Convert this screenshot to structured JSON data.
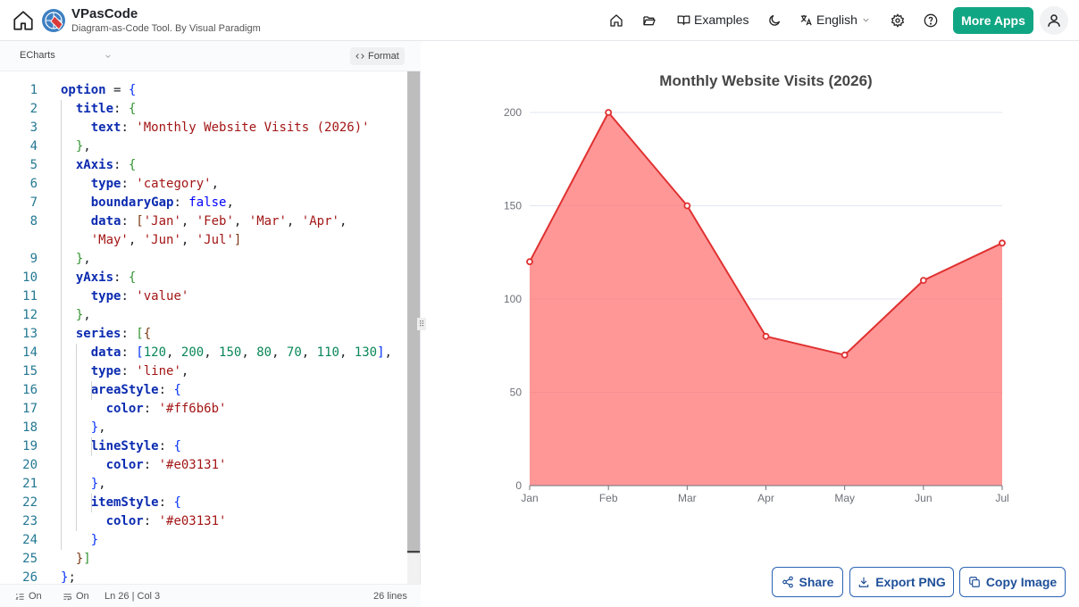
{
  "header": {
    "brand_title": "VPasCode",
    "brand_subtitle": "Diagram-as-Code Tool. By Visual Paradigm",
    "examples_label": "Examples",
    "language_label": "English",
    "more_apps_label": "More Apps"
  },
  "editor": {
    "language": "ECharts",
    "format_label": "Format",
    "lines": [
      {
        "n": "1",
        "html": "<span class=\"k\">option</span> = <span class=\"p1\">{</span>"
      },
      {
        "n": "2",
        "html": "  <span class=\"k\">title</span>: <span class=\"p2\">{</span>"
      },
      {
        "n": "3",
        "html": "    <span class=\"k\">text</span>: <span class=\"s\">'Monthly Website Visits (2026)'</span>"
      },
      {
        "n": "4",
        "html": "  <span class=\"p2\">}</span>,"
      },
      {
        "n": "5",
        "html": "  <span class=\"k\">xAxis</span>: <span class=\"p2\">{</span>"
      },
      {
        "n": "6",
        "html": "    <span class=\"k\">type</span>: <span class=\"s\">'category'</span>,"
      },
      {
        "n": "7",
        "html": "    <span class=\"k\">boundaryGap</span>: <span class=\"b\">false</span>,"
      },
      {
        "n": "8",
        "html": "    <span class=\"k\">data</span>: <span class=\"p3\">[</span><span class=\"s\">'Jan'</span>, <span class=\"s\">'Feb'</span>, <span class=\"s\">'Mar'</span>, <span class=\"s\">'Apr'</span>,"
      },
      {
        "n": "",
        "html": "    <span class=\"s\">'May'</span>, <span class=\"s\">'Jun'</span>, <span class=\"s\">'Jul'</span><span class=\"p3\">]</span>"
      },
      {
        "n": "9",
        "html": "  <span class=\"p2\">}</span>,"
      },
      {
        "n": "10",
        "html": "  <span class=\"k\">yAxis</span>: <span class=\"p2\">{</span>"
      },
      {
        "n": "11",
        "html": "    <span class=\"k\">type</span>: <span class=\"s\">'value'</span>"
      },
      {
        "n": "12",
        "html": "  <span class=\"p2\">}</span>,"
      },
      {
        "n": "13",
        "html": "  <span class=\"k\">series</span>: <span class=\"p2\">[</span><span class=\"p3\">{</span>"
      },
      {
        "n": "14",
        "html": "    <span class=\"k\">data</span>: <span class=\"p1\">[</span><span class=\"n\">120</span>, <span class=\"n\">200</span>, <span class=\"n\">150</span>, <span class=\"n\">80</span>, <span class=\"n\">70</span>, <span class=\"n\">110</span>, <span class=\"n\">130</span><span class=\"p1\">]</span>,"
      },
      {
        "n": "15",
        "html": "    <span class=\"k\">type</span>: <span class=\"s\">'line'</span>,"
      },
      {
        "n": "16",
        "html": "    <span class=\"k\">areaStyle</span>: <span class=\"p1\">{</span>"
      },
      {
        "n": "17",
        "html": "      <span class=\"k\">color</span>: <span class=\"s\">'#ff6b6b'</span>"
      },
      {
        "n": "18",
        "html": "    <span class=\"p1\">}</span>,"
      },
      {
        "n": "19",
        "html": "    <span class=\"k\">lineStyle</span>: <span class=\"p1\">{</span>"
      },
      {
        "n": "20",
        "html": "      <span class=\"k\">color</span>: <span class=\"s\">'#e03131'</span>"
      },
      {
        "n": "21",
        "html": "    <span class=\"p1\">}</span>,"
      },
      {
        "n": "22",
        "html": "    <span class=\"k\">itemStyle</span>: <span class=\"p1\">{</span>"
      },
      {
        "n": "23",
        "html": "      <span class=\"k\">color</span>: <span class=\"s\">'#e03131'</span>"
      },
      {
        "n": "24",
        "html": "    <span class=\"p1\">}</span>"
      },
      {
        "n": "25",
        "html": "  <span class=\"p3\">}</span><span class=\"p2\">]</span>"
      },
      {
        "n": "26",
        "html": "<span class=\"p1\">}</span>;"
      }
    ],
    "status": {
      "toggle1": "On",
      "toggle2": "On",
      "cursor": "Ln 26 | Col 3",
      "line_count": "26 lines"
    }
  },
  "chart_data": {
    "type": "area",
    "title": "Monthly Website Visits (2026)",
    "categories": [
      "Jan",
      "Feb",
      "Mar",
      "Apr",
      "May",
      "Jun",
      "Jul"
    ],
    "values": [
      120,
      200,
      150,
      80,
      70,
      110,
      130
    ],
    "yticks": [
      0,
      50,
      100,
      150,
      200
    ],
    "ylim": [
      0,
      200
    ],
    "grid": true,
    "area_color": "#ff6b6b",
    "line_color": "#e03131"
  },
  "actions": {
    "share_label": "Share",
    "export_label": "Export PNG",
    "copy_label": "Copy Image"
  }
}
